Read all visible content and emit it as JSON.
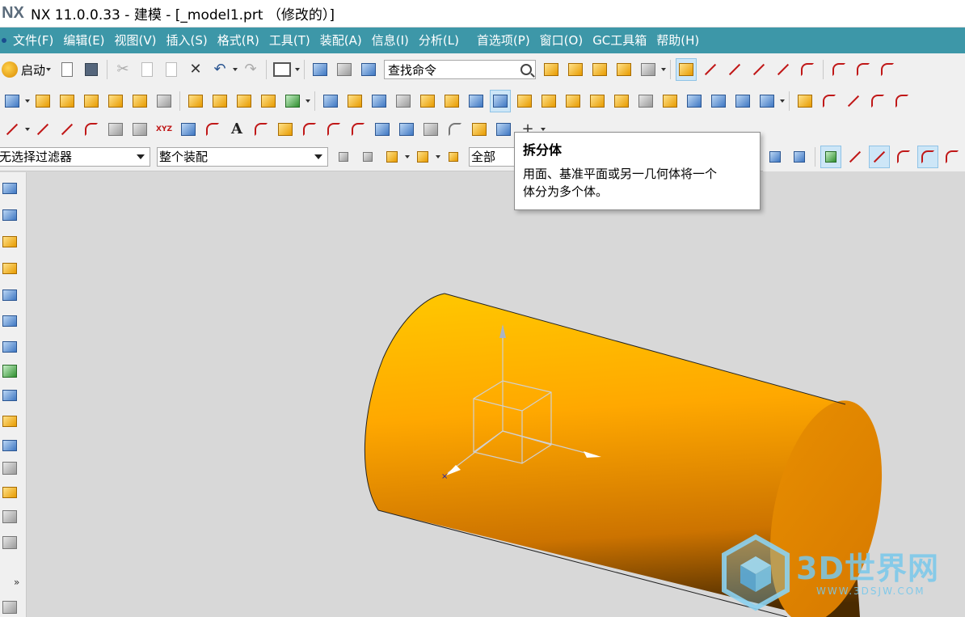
{
  "window": {
    "logo_text": "NX",
    "title": "NX 11.0.0.33 - 建模 - [_model1.prt （修改的）]"
  },
  "menubar": {
    "items": [
      {
        "label": "文件(F)"
      },
      {
        "label": "编辑(E)"
      },
      {
        "label": "视图(V)"
      },
      {
        "label": "插入(S)"
      },
      {
        "label": "格式(R)"
      },
      {
        "label": "工具(T)"
      },
      {
        "label": "装配(A)"
      },
      {
        "label": "信息(I)"
      },
      {
        "label": "分析(L)"
      },
      {
        "label": "首选项(P)"
      },
      {
        "label": "窗口(O)"
      },
      {
        "label": "GC工具箱"
      },
      {
        "label": "帮助(H)"
      }
    ]
  },
  "toolbar": {
    "start_label": "启动",
    "search_value": "查找命令",
    "selection_filter": "无选择过滤器",
    "scope": "整个装配",
    "type_filter": "全部"
  },
  "tooltip": {
    "title": "拆分体",
    "body_line1": "用面、基准平面或另一几何体将一个",
    "body_line2": "体分为多个体。"
  },
  "watermark": {
    "text": "3D世界网",
    "subtext": "WWW.3DSJW.COM"
  },
  "colors": {
    "menubar": "#3d97a8",
    "viewport_bg": "#d8d8d8",
    "cylinder": "#f7a800",
    "cylinder_end": "#e08800"
  }
}
